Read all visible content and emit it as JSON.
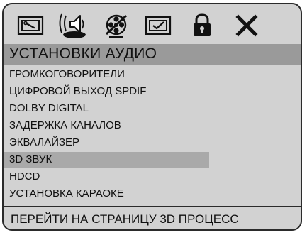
{
  "toolbar": {
    "icons": [
      "general-setup-icon",
      "audio-setup-icon",
      "video-setup-icon",
      "preferences-icon",
      "password-lock-icon",
      "exit-icon"
    ]
  },
  "title": "УСТАНОВКИ АУДИО",
  "menu": {
    "items": [
      {
        "label": "ГРОМКОГОВОРИТЕЛИ"
      },
      {
        "label": "ЦИФРОВОЙ ВЫХОД SPDIF"
      },
      {
        "label": "DOLBY DIGITAL"
      },
      {
        "label": "ЗАДЕРЖКА КАНАЛОВ"
      },
      {
        "label": "ЭКВАЛАЙЗЕР"
      },
      {
        "label": "3D ЗВУК"
      },
      {
        "label": "HDCD"
      },
      {
        "label": "УСТАНОВКА КАРАОКЕ"
      }
    ],
    "selected_index": 5
  },
  "footer": "ПЕРЕЙТИ НА СТРАНИЦУ 3D ПРОЦЕСС",
  "colors": {
    "background": "#d2d2d2",
    "title_bar": "#9a9a9a",
    "selection": "#a9a9a9",
    "border": "#2b2b2b"
  }
}
